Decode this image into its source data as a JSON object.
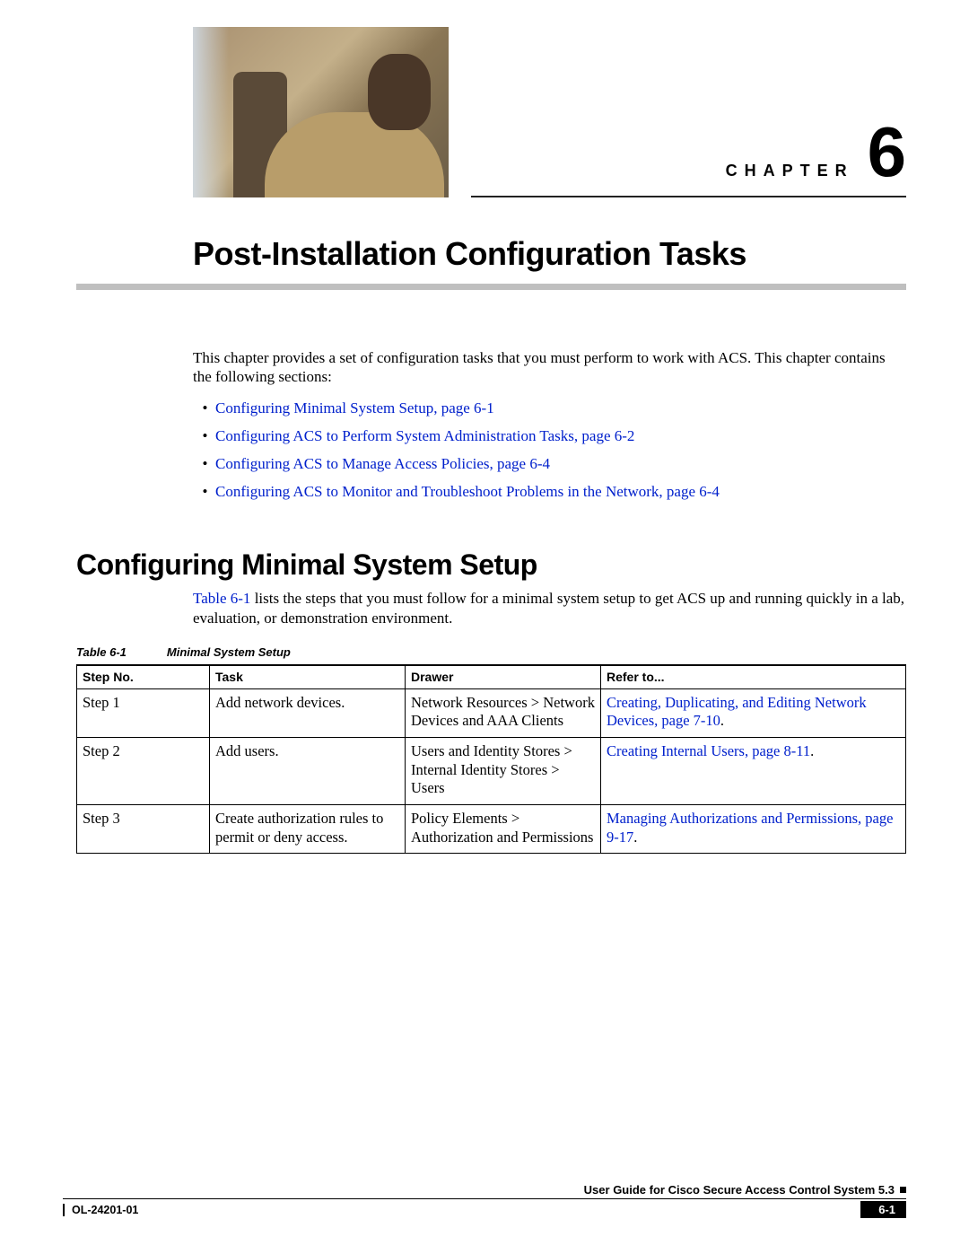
{
  "chapter": {
    "label": "CHAPTER",
    "number": "6"
  },
  "title": "Post-Installation Configuration Tasks",
  "intro": "This chapter provides a set of configuration tasks that you must perform to work with ACS. This chapter contains the following sections:",
  "links": [
    "Configuring Minimal System Setup, page 6-1",
    "Configuring ACS to Perform System Administration Tasks, page 6-2",
    "Configuring ACS to Manage Access Policies, page 6-4",
    "Configuring ACS to Monitor and Troubleshoot Problems in the Network, page 6-4"
  ],
  "section_heading": "Configuring Minimal System Setup",
  "section_body": {
    "link": "Table 6-1",
    "rest": " lists the steps that you must follow for a minimal system setup to get ACS up and running quickly in a lab, evaluation, or demonstration environment."
  },
  "table_caption": {
    "num": "Table 6-1",
    "title": "Minimal System Setup"
  },
  "table": {
    "headers": [
      "Step No.",
      "Task",
      "Drawer",
      "Refer to..."
    ],
    "rows": [
      {
        "step": "Step 1",
        "task": "Add network devices.",
        "drawer": "Network Resources > Network Devices and AAA Clients",
        "refer_link": "Creating, Duplicating, and Editing Network Devices, page 7-10",
        "refer_tail": "."
      },
      {
        "step": "Step 2",
        "task": "Add users.",
        "drawer": "Users and Identity Stores > Internal Identity Stores > Users",
        "refer_link": "Creating Internal Users, page 8-11",
        "refer_tail": "."
      },
      {
        "step": "Step 3",
        "task": "Create authorization rules to permit or deny access.",
        "drawer": "Policy Elements > Authorization and Permissions",
        "refer_link": "Managing Authorizations and Permissions, page 9-17",
        "refer_tail": "."
      }
    ]
  },
  "footer": {
    "guide": "User Guide for Cisco Secure Access Control System 5.3",
    "ol": "OL-24201-01",
    "page": "6-1"
  }
}
